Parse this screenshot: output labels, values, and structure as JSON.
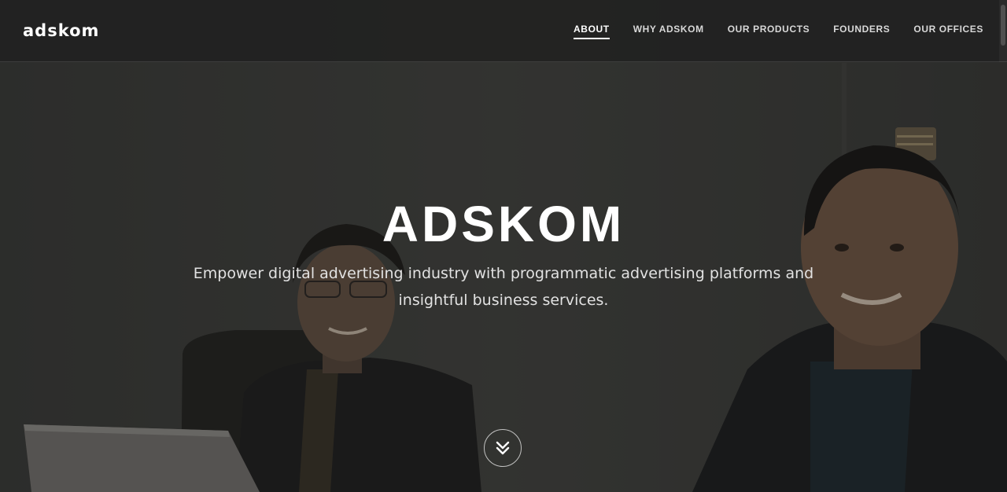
{
  "brand": {
    "logo_text": "adskom"
  },
  "nav": {
    "items": [
      {
        "label": "ABOUT",
        "active": true
      },
      {
        "label": "WHY ADSKOM",
        "active": false
      },
      {
        "label": "OUR PRODUCTS",
        "active": false
      },
      {
        "label": "FOUNDERS",
        "active": false
      },
      {
        "label": "OUR OFFICES",
        "active": false
      }
    ]
  },
  "hero": {
    "title": "ADSKOM",
    "tagline": "Empower digital advertising industry with programmatic advertising platforms and insightful business services.",
    "scroll_icon": "double-chevron-down-icon"
  },
  "colors": {
    "navbar_bg": "#222222",
    "text_primary": "#ffffff",
    "text_secondary": "#e2e2e2"
  }
}
